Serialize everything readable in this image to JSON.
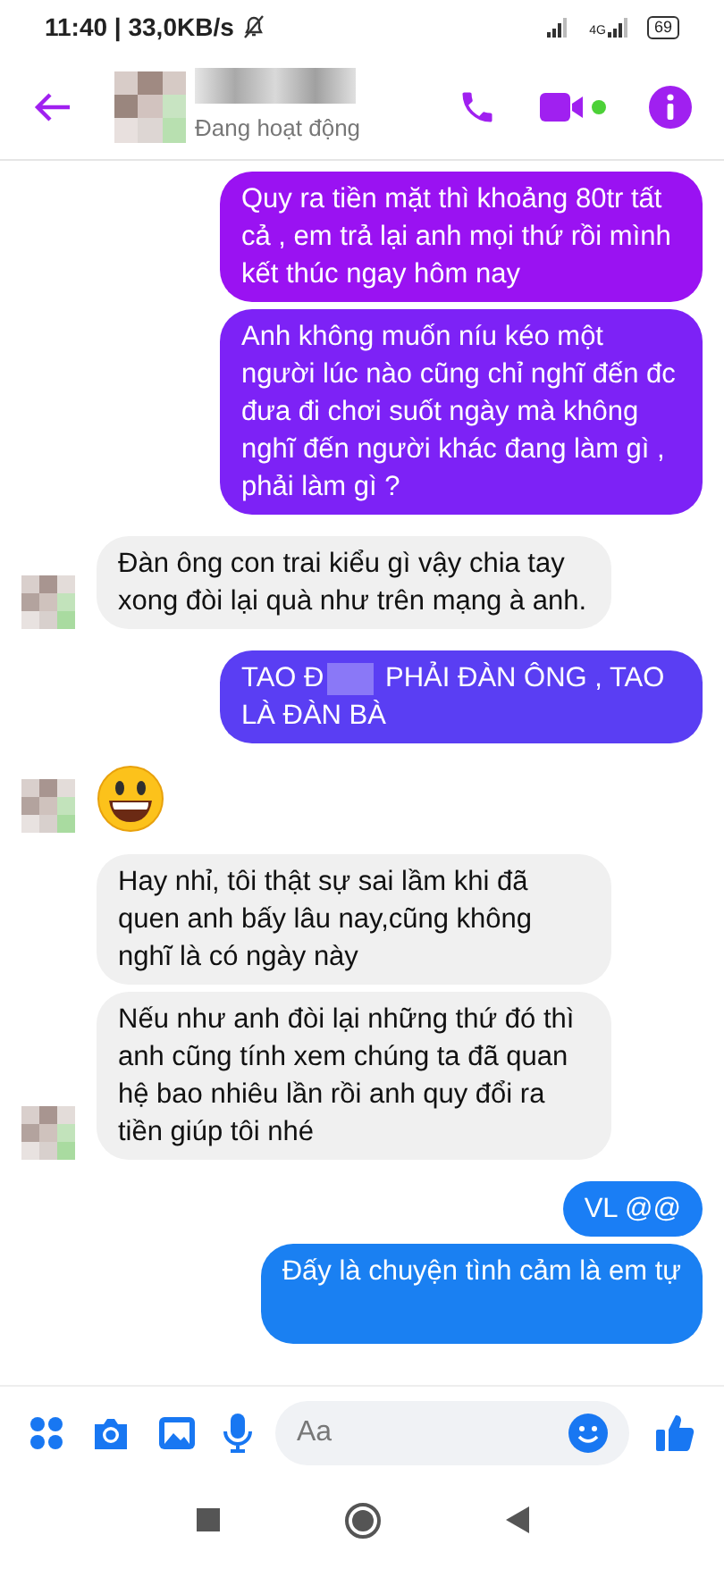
{
  "status_bar": {
    "time": "11:40 | 33,0KB/s",
    "battery": "69",
    "network": "4G"
  },
  "header": {
    "status": "Đang hoạt động",
    "active_dot": true
  },
  "messages": [
    {
      "kind": "sent",
      "text": "Quy ra tiền mặt thì khoảng 80tr tất cả , em trả lại anh mọi thứ rồi mình kết thúc ngay hôm nay",
      "color": "#9a12f2"
    },
    {
      "kind": "sent",
      "text": "Anh không muốn níu kéo một người lúc nào cũng chỉ nghĩ đến đc đưa đi chơi suốt ngày mà không nghĩ đến người khác đang làm gì , phải làm gì ?",
      "color": "#7d22f6"
    },
    {
      "kind": "received",
      "text": "Đàn ông con trai kiểu gì vậy chia tay xong đòi lại quà như trên mạng à anh.",
      "avatar": true
    },
    {
      "kind": "sent_redacted",
      "text_before": "TAO Đ",
      "text_after": "PHẢI ĐÀN ÔNG , TAO LÀ ĐÀN BÀ",
      "color": "#5a3ef3"
    },
    {
      "kind": "emoji",
      "avatar": true
    },
    {
      "kind": "received",
      "text": "Hay nhỉ, tôi thật sự sai lầm khi đã quen anh bấy lâu nay,cũng không nghĩ là có ngày này",
      "avatar": false
    },
    {
      "kind": "received",
      "text": "Nếu như anh đòi lại những thứ đó thì anh cũng tính xem chúng ta đã quan hệ bao nhiêu lần rồi anh quy đổi ra tiền giúp tôi nhé",
      "avatar": true
    },
    {
      "kind": "sent",
      "text": "VL @@",
      "color": "#1a7ef5"
    },
    {
      "kind": "sent",
      "text": "Đấy là chuyện tình cảm là em tự",
      "color": "#1a80f2"
    }
  ],
  "composer": {
    "placeholder": "Aa"
  }
}
